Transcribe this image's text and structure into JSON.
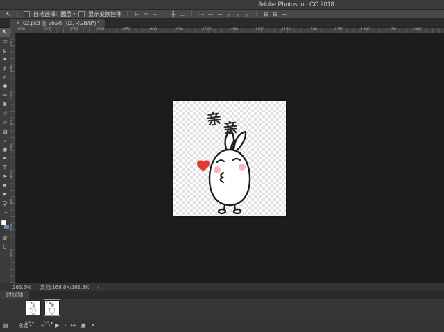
{
  "titlebar": {
    "title": "Adobe Photoshop CC 2018"
  },
  "options_bar": {
    "tool_icon": "↖",
    "auto_select": {
      "label": "自动选择:",
      "checked": false
    },
    "layer_dropdown": {
      "value": "图层",
      "chevron": "▾"
    },
    "show_transform": {
      "label": "显示变换控件",
      "checked": false
    },
    "align_icons": [
      {
        "name": "align-left-icon",
        "glyph": "⊢"
      },
      {
        "name": "align-center-horizontal-icon",
        "glyph": "╪"
      },
      {
        "name": "align-right-icon",
        "glyph": "⊣"
      },
      {
        "name": "align-top-icon",
        "glyph": "⊤"
      },
      {
        "name": "align-middle-icon",
        "glyph": "╫"
      },
      {
        "name": "align-bottom-icon",
        "glyph": "⊥"
      }
    ],
    "distribute_icons": [
      {
        "name": "distribute-top-icon",
        "glyph": "⋯"
      },
      {
        "name": "distribute-vertical-center-icon",
        "glyph": "⋯"
      },
      {
        "name": "distribute-bottom-icon",
        "glyph": "⋯"
      },
      {
        "name": "distribute-left-icon",
        "glyph": "⋮"
      },
      {
        "name": "distribute-horizontal-center-icon",
        "glyph": "⋮"
      },
      {
        "name": "distribute-right-icon",
        "glyph": "⋮"
      }
    ],
    "extra_icons": [
      {
        "name": "distribute-spacing-icon",
        "glyph": "⊞"
      },
      {
        "name": "align-to-selection-icon",
        "glyph": "⊟"
      },
      {
        "name": "3d-mode-icon",
        "glyph": "⊹"
      }
    ]
  },
  "tab_bar": {
    "close": "×",
    "title": "02.psd @ 265% (02, RGB/8*) *"
  },
  "rulers": {
    "horizontal": [
      "650",
      "700",
      "750",
      "800",
      "850",
      "900",
      "950",
      "1000",
      "1050",
      "1100",
      "1150",
      "1200",
      "1250",
      "1300",
      "1350",
      "1400"
    ],
    "vertical": [
      "150",
      "200",
      "250",
      "300",
      "350",
      "400",
      "450",
      "500",
      "550"
    ]
  },
  "toolbar": {
    "foreground_color": "#ffffff",
    "background_color": "#5f8fc7",
    "tools": [
      {
        "name": "move-tool",
        "glyph": "↖",
        "active": true
      },
      {
        "name": "rectangular-marquee-tool",
        "glyph": "▭"
      },
      {
        "name": "lasso-tool",
        "glyph": "ϱ"
      },
      {
        "name": "quick-selection-tool",
        "glyph": "✦"
      },
      {
        "name": "crop-tool",
        "glyph": "♯"
      },
      {
        "name": "eyedropper-tool",
        "glyph": "✐"
      },
      {
        "name": "healing-brush-tool",
        "glyph": "✚"
      },
      {
        "name": "brush-tool",
        "glyph": "✏"
      },
      {
        "name": "clone-stamp-tool",
        "glyph": "♜"
      },
      {
        "name": "history-brush-tool",
        "glyph": "↺"
      },
      {
        "name": "eraser-tool",
        "glyph": "▱"
      },
      {
        "name": "gradient-tool",
        "glyph": "▨"
      },
      {
        "name": "blur-tool",
        "glyph": "◒"
      },
      {
        "name": "dodge-tool",
        "glyph": "◉"
      },
      {
        "name": "pen-tool",
        "glyph": "✒"
      },
      {
        "name": "type-tool",
        "glyph": "T"
      },
      {
        "name": "path-selection-tool",
        "glyph": "➤"
      },
      {
        "name": "shape-tool",
        "glyph": "■"
      },
      {
        "name": "hand-tool",
        "glyph": "☛"
      },
      {
        "name": "zoom-tool",
        "glyph": "Ϙ"
      },
      {
        "name": "edit-toolbar-icon",
        "glyph": "⋯"
      }
    ],
    "bottom_items": [
      {
        "name": "quick-mask-icon",
        "glyph": "◍"
      },
      {
        "name": "screen-mode-icon",
        "glyph": "▯"
      }
    ]
  },
  "canvas": {
    "caption_char_1": "亲",
    "caption_char_2": "亲",
    "colors": {
      "heart": "#e63a31",
      "blush": "#f7b6c4",
      "outline": "#1f1f1f"
    }
  },
  "status_bar": {
    "zoom": "265.5%",
    "doc_label": "文档:168.8K/168.8K",
    "popup": "›"
  },
  "timeline": {
    "tab_label": "时间轴",
    "frames": [
      {
        "number": "1",
        "delay": "0.5",
        "chevron": "▾",
        "selected": false
      },
      {
        "number": "2",
        "delay": "0.5",
        "chevron": "▾",
        "selected": true
      }
    ],
    "controls": [
      {
        "name": "convert-video-timeline-icon",
        "type": "icon",
        "glyph": "▤"
      },
      {
        "name": "loop-select",
        "type": "select",
        "label": "永远",
        "chevron": "▾"
      },
      {
        "name": "first-frame-button",
        "type": "icon",
        "glyph": "«"
      },
      {
        "name": "previous-frame-button",
        "type": "icon",
        "glyph": "‹"
      },
      {
        "name": "play-button",
        "type": "icon",
        "glyph": "▶"
      },
      {
        "name": "next-frame-button",
        "type": "icon",
        "glyph": "›"
      },
      {
        "name": "tween-button",
        "type": "icon",
        "glyph": "↦"
      },
      {
        "name": "duplicate-frame-button",
        "type": "icon",
        "glyph": "▣"
      },
      {
        "name": "delete-frame-button",
        "type": "icon",
        "glyph": "✕"
      }
    ]
  }
}
